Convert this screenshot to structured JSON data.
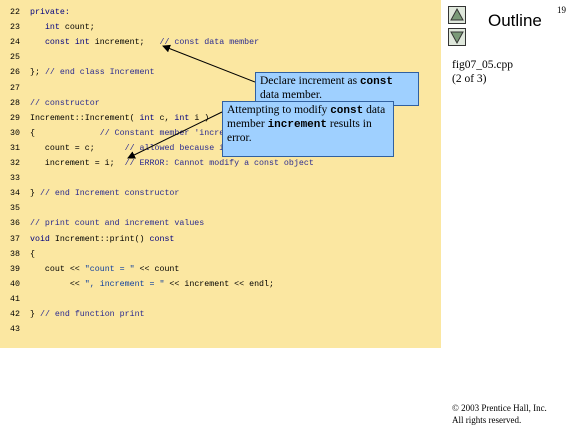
{
  "slide_number": "19",
  "outline": {
    "title": "Outline"
  },
  "file": {
    "name": "fig07_05.cpp",
    "part": "(2 of 3)"
  },
  "copyright": {
    "line1": "© 2003 Prentice Hall, Inc.",
    "line2": "All rights reserved."
  },
  "nav": {
    "up_icon": "triangle-up-icon",
    "down_icon": "triangle-down-icon"
  },
  "code": [
    {
      "n": "22",
      "segments": [
        {
          "t": "private:",
          "c": "kw"
        }
      ]
    },
    {
      "n": "23",
      "segments": [
        {
          "t": "   "
        },
        {
          "t": "int",
          "c": "kw"
        },
        {
          "t": " count;"
        }
      ]
    },
    {
      "n": "24",
      "segments": [
        {
          "t": "   "
        },
        {
          "t": "const",
          "c": "kw"
        },
        {
          "t": " "
        },
        {
          "t": "int",
          "c": "kw"
        },
        {
          "t": " increment;   "
        },
        {
          "t": "// const data member",
          "c": "cm"
        }
      ]
    },
    {
      "n": "25",
      "segments": []
    },
    {
      "n": "26",
      "segments": [
        {
          "t": "}; "
        },
        {
          "t": "// end class Increment",
          "c": "cm"
        }
      ]
    },
    {
      "n": "27",
      "segments": []
    },
    {
      "n": "28",
      "segments": [
        {
          "t": "// constructor",
          "c": "cm"
        }
      ]
    },
    {
      "n": "29",
      "segments": [
        {
          "t": "Increment::Increment( "
        },
        {
          "t": "int",
          "c": "kw"
        },
        {
          "t": " c, "
        },
        {
          "t": "int",
          "c": "kw"
        },
        {
          "t": " i )"
        }
      ]
    },
    {
      "n": "30",
      "segments": [
        {
          "t": "{             "
        },
        {
          "t": "// Constant member 'increment' is not",
          "c": "cm"
        }
      ]
    },
    {
      "n": "31",
      "segments": [
        {
          "t": "   count = c;      "
        },
        {
          "t": "// allowed because it's",
          "c": "cm"
        }
      ]
    },
    {
      "n": "32",
      "segments": [
        {
          "t": "   increment = i;  "
        },
        {
          "t": "// ERROR: Cannot modify a const object",
          "c": "cm"
        }
      ]
    },
    {
      "n": "33",
      "segments": []
    },
    {
      "n": "34",
      "segments": [
        {
          "t": "} "
        },
        {
          "t": "// end Increment constructor",
          "c": "cm"
        }
      ]
    },
    {
      "n": "35",
      "segments": []
    },
    {
      "n": "36",
      "segments": [
        {
          "t": "// print count and increment values",
          "c": "cm"
        }
      ]
    },
    {
      "n": "37",
      "segments": [
        {
          "t": "void",
          "c": "kw"
        },
        {
          "t": " Increment::print() "
        },
        {
          "t": "const",
          "c": "kw"
        }
      ]
    },
    {
      "n": "38",
      "segments": [
        {
          "t": "{"
        }
      ]
    },
    {
      "n": "39",
      "segments": [
        {
          "t": "   cout << "
        },
        {
          "t": "\"count = \"",
          "c": "st"
        },
        {
          "t": " << count"
        }
      ]
    },
    {
      "n": "40",
      "segments": [
        {
          "t": "        << "
        },
        {
          "t": "\", increment = \"",
          "c": "st"
        },
        {
          "t": " << increment << endl;"
        }
      ]
    },
    {
      "n": "41",
      "segments": []
    },
    {
      "n": "42",
      "segments": [
        {
          "t": "} "
        },
        {
          "t": "// end function print",
          "c": "cm"
        }
      ]
    },
    {
      "n": "43",
      "segments": []
    }
  ],
  "callouts": [
    {
      "id": "declare",
      "parts": [
        {
          "t": "Declare increment as "
        },
        {
          "t": "const",
          "mono": true
        },
        {
          "t": " data member."
        }
      ]
    },
    {
      "id": "modify",
      "parts": [
        {
          "t": "Attempting to modify "
        },
        {
          "t": "const",
          "mono": true
        },
        {
          "t": " data member "
        },
        {
          "t": "increment",
          "mono": true
        },
        {
          "t": " results in error."
        }
      ]
    }
  ],
  "colors": {
    "code_bg": "#fbe7a1",
    "callout_bg": "#9fd0ff",
    "keyword": "#000080",
    "comment": "#2a2a90"
  }
}
